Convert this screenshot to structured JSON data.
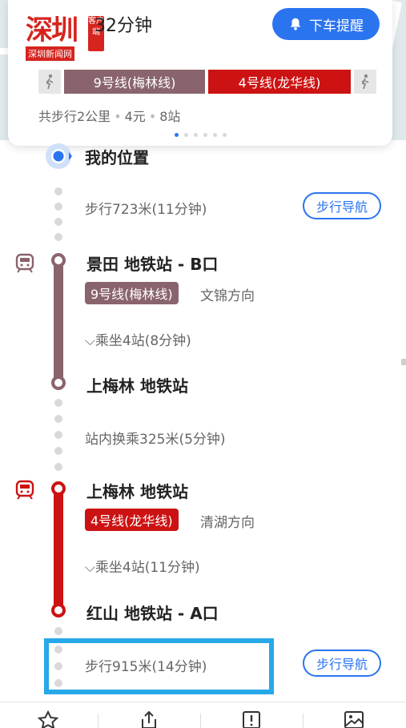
{
  "header": {
    "logo_main": "深圳",
    "logo_badge": "客户端",
    "logo_sub": "深圳新闻网",
    "duration": "32分钟",
    "alert_button": "下车提醒"
  },
  "route_summary": {
    "line_chips": [
      "9号线(梅林线)",
      "4号线(龙华线)"
    ],
    "walk": "共步行2公里",
    "fare": "4元",
    "stops": "8站",
    "page_count": 6,
    "active_page": 1
  },
  "steps": {
    "start": "我的位置",
    "walk1": "步行723米(11分钟)",
    "walk_nav_label": "步行导航",
    "leg1": {
      "board_station": "景田 地铁站 - B口",
      "line_name": "9号线(梅林线)",
      "direction": "文锦方向",
      "ride_info": "乘坐4站(8分钟)",
      "alight_station": "上梅林 地铁站"
    },
    "transfer": "站内换乘325米(5分钟)",
    "leg2": {
      "board_station": "上梅林 地铁站",
      "line_name": "4号线(龙华线)",
      "direction": "清湖方向",
      "ride_info": "乘坐4站(11分钟)",
      "alight_station": "红山 地铁站 - A口"
    },
    "walk2": "步行915米(14分钟)",
    "walk2_nav_label": "步行导航"
  },
  "colors": {
    "line9": "#8a646c",
    "line4": "#cc1212",
    "accent": "#2b74f0",
    "highlight": "#27a8e8"
  },
  "icons": [
    "bell-icon",
    "walk-icon",
    "metro-icon",
    "star-icon",
    "share-icon",
    "report-icon",
    "image-icon"
  ]
}
